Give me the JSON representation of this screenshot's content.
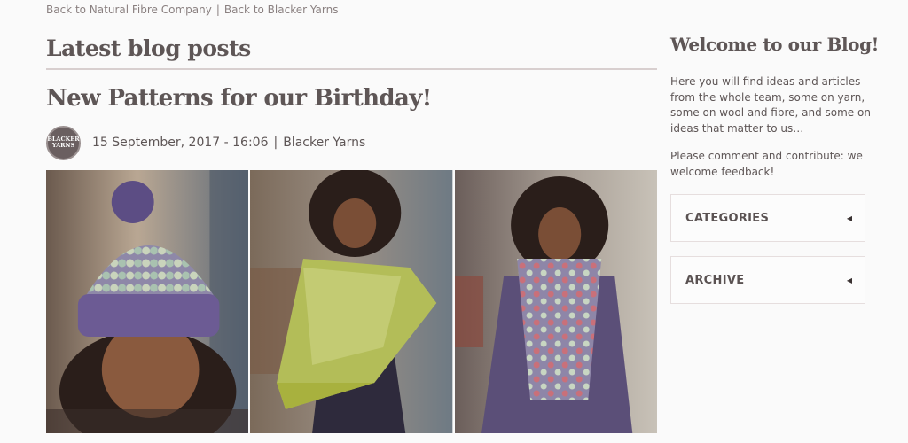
{
  "topnav": {
    "link1": "Back to Natural Fibre Company",
    "separator": "|",
    "link2": "Back to Blacker Yarns"
  },
  "main": {
    "section_title": "Latest blog posts",
    "post": {
      "title": "New Patterns for our Birthday!",
      "avatar_text": {
        "line1": "BLACKER",
        "line2": "YARNS"
      },
      "date": "15 September, 2017 - 16:06",
      "separator": "|",
      "author": "Blacker Yarns"
    }
  },
  "sidebar": {
    "title": "Welcome to our Blog!",
    "intro": "Here you will find ideas and articles from the whole team, some on yarn, some on wool and fibre, and some on ideas that matter to us…",
    "feedback": "Please comment and contribute: we welcome feedback!",
    "boxes": [
      {
        "label": "CATEGORIES",
        "icon": "caret-left-icon"
      },
      {
        "label": "ARCHIVE",
        "icon": "caret-left-icon"
      }
    ]
  },
  "colors": {
    "background": "#fafafa",
    "text": "#5e5656",
    "muted_link": "#8a8080",
    "rule": "#d8cfcf"
  }
}
